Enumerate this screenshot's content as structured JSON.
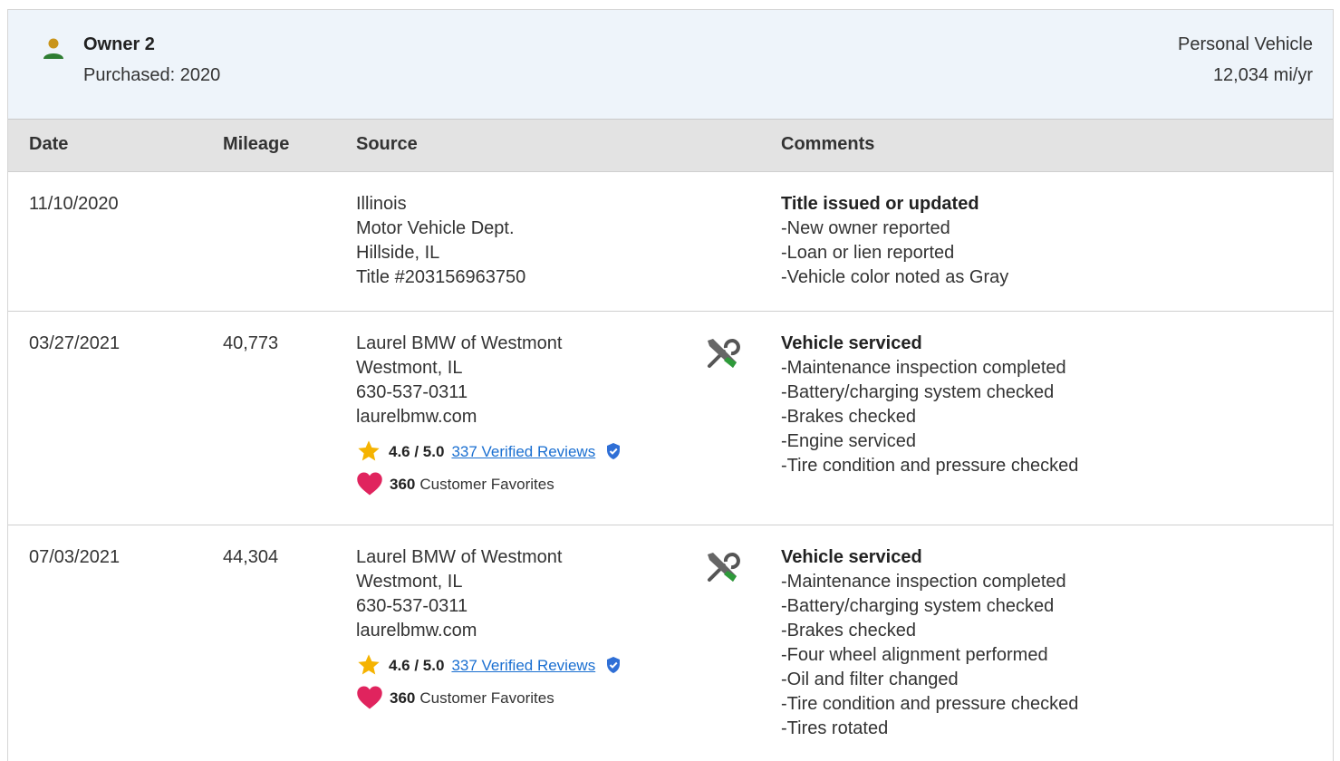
{
  "owner": {
    "name": "Owner 2",
    "purchased": "Purchased: 2020",
    "usage": "Personal Vehicle",
    "miles_per_year": "12,034 mi/yr",
    "icon": "person-icon",
    "icon_color": "#2e7d32"
  },
  "columns": {
    "date": "Date",
    "mileage": "Mileage",
    "source": "Source",
    "comments": "Comments"
  },
  "records": [
    {
      "date": "11/10/2020",
      "mileage": "",
      "source": [
        "Illinois",
        "Motor Vehicle Dept.",
        "Hillside, IL",
        "Title #203156963750"
      ],
      "comment_title": "Title issued or updated",
      "comments": [
        "New owner reported",
        "Loan or lien reported",
        "Vehicle color noted as Gray"
      ]
    },
    {
      "date": "03/27/2021",
      "mileage": "40,773",
      "source": [
        "Laurel BMW of Westmont",
        "Westmont, IL",
        "630-537-0311",
        "laurelbmw.com"
      ],
      "rating": "4.6 / 5.0",
      "reviews": "337 Verified Reviews",
      "favorites_count": "360",
      "favorites_label": "Customer Favorites",
      "icon": "service-tools-icon",
      "comment_title": "Vehicle serviced",
      "comments": [
        "Maintenance inspection completed",
        "Battery/charging system checked",
        "Brakes checked",
        "Engine serviced",
        "Tire condition and pressure checked"
      ]
    },
    {
      "date": "07/03/2021",
      "mileage": "44,304",
      "source": [
        "Laurel BMW of Westmont",
        "Westmont, IL",
        "630-537-0311",
        "laurelbmw.com"
      ],
      "rating": "4.6 / 5.0",
      "reviews": "337 Verified Reviews",
      "favorites_count": "360",
      "favorites_label": "Customer Favorites",
      "icon": "service-tools-icon",
      "comment_title": "Vehicle serviced",
      "comments": [
        "Maintenance inspection completed",
        "Battery/charging system checked",
        "Brakes checked",
        "Four wheel alignment performed",
        "Oil and filter changed",
        "Tire condition and pressure checked",
        "Tires rotated"
      ]
    }
  ],
  "colors": {
    "header_bg": "#eef4fa",
    "table_head_bg": "#e3e3e3",
    "link": "#1a6fd1",
    "star": "#f5b301",
    "heart": "#e0245e",
    "verified": "#2f6fd6"
  }
}
